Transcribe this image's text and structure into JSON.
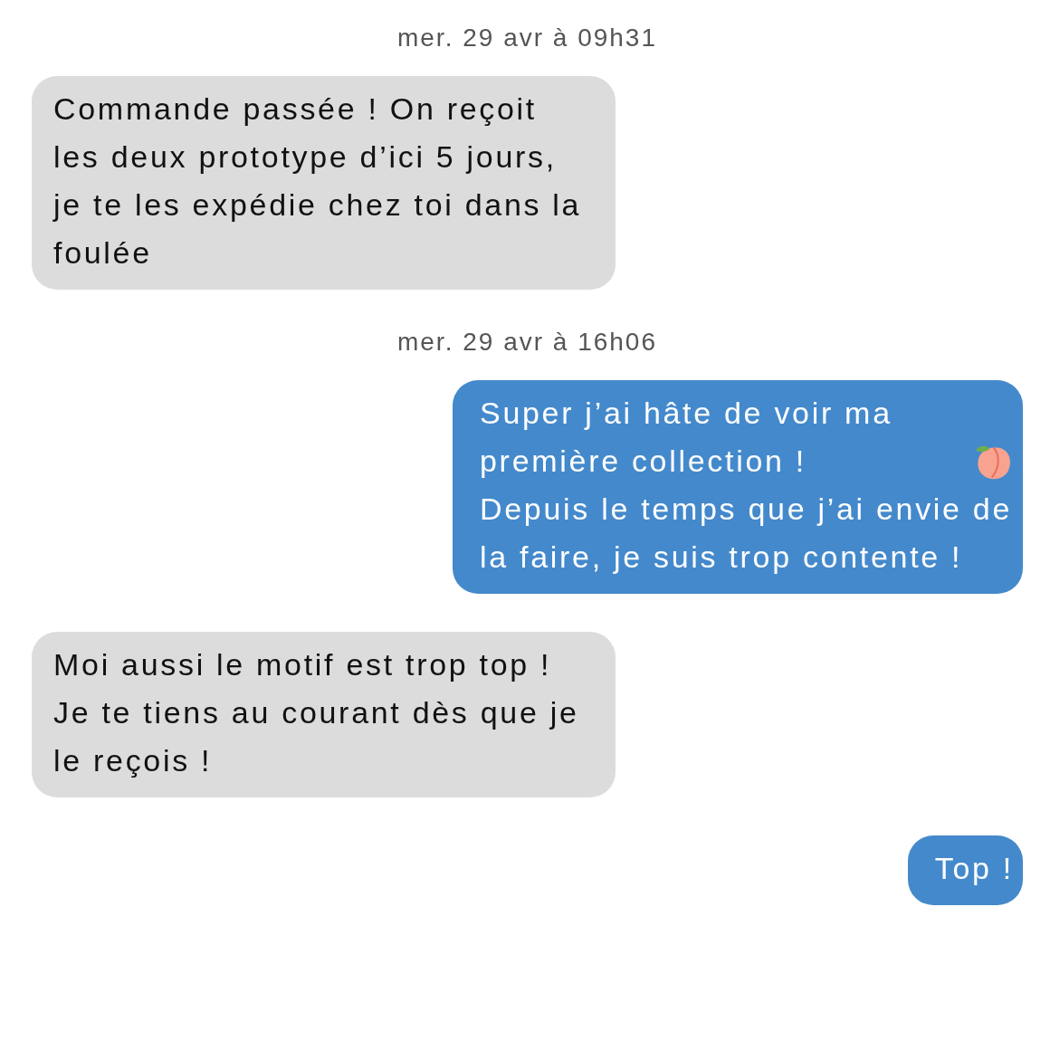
{
  "messages": [
    {
      "kind": "timestamp",
      "text": "mer. 29 avr à 09h31"
    },
    {
      "kind": "bubble",
      "outgoing": false,
      "parts": [
        {
          "kind": "text",
          "text": "Commande passée ! On reçoit les deux prototype d’ici 5 jours, je te les expédie chez toi dans la foulée"
        }
      ]
    },
    {
      "kind": "timestamp",
      "text": "mer. 29 avr à 16h06"
    },
    {
      "kind": "bubble",
      "outgoing": true,
      "parts": [
        {
          "kind": "text",
          "text": "Super j’ai hâte de voir ma première collection !"
        },
        {
          "kind": "peach"
        },
        {
          "kind": "text",
          "text": "Depuis le temps que j’ai envie de la faire, je suis trop contente !"
        }
      ]
    },
    {
      "kind": "bubble",
      "outgoing": false,
      "parts": [
        {
          "kind": "text",
          "text": "Moi aussi le motif est trop top ! Je te tiens au courant dès que je le reçois !"
        }
      ]
    },
    {
      "kind": "bubble",
      "outgoing": true,
      "parts": [
        {
          "kind": "text",
          "text": "Top !"
        }
      ]
    }
  ]
}
